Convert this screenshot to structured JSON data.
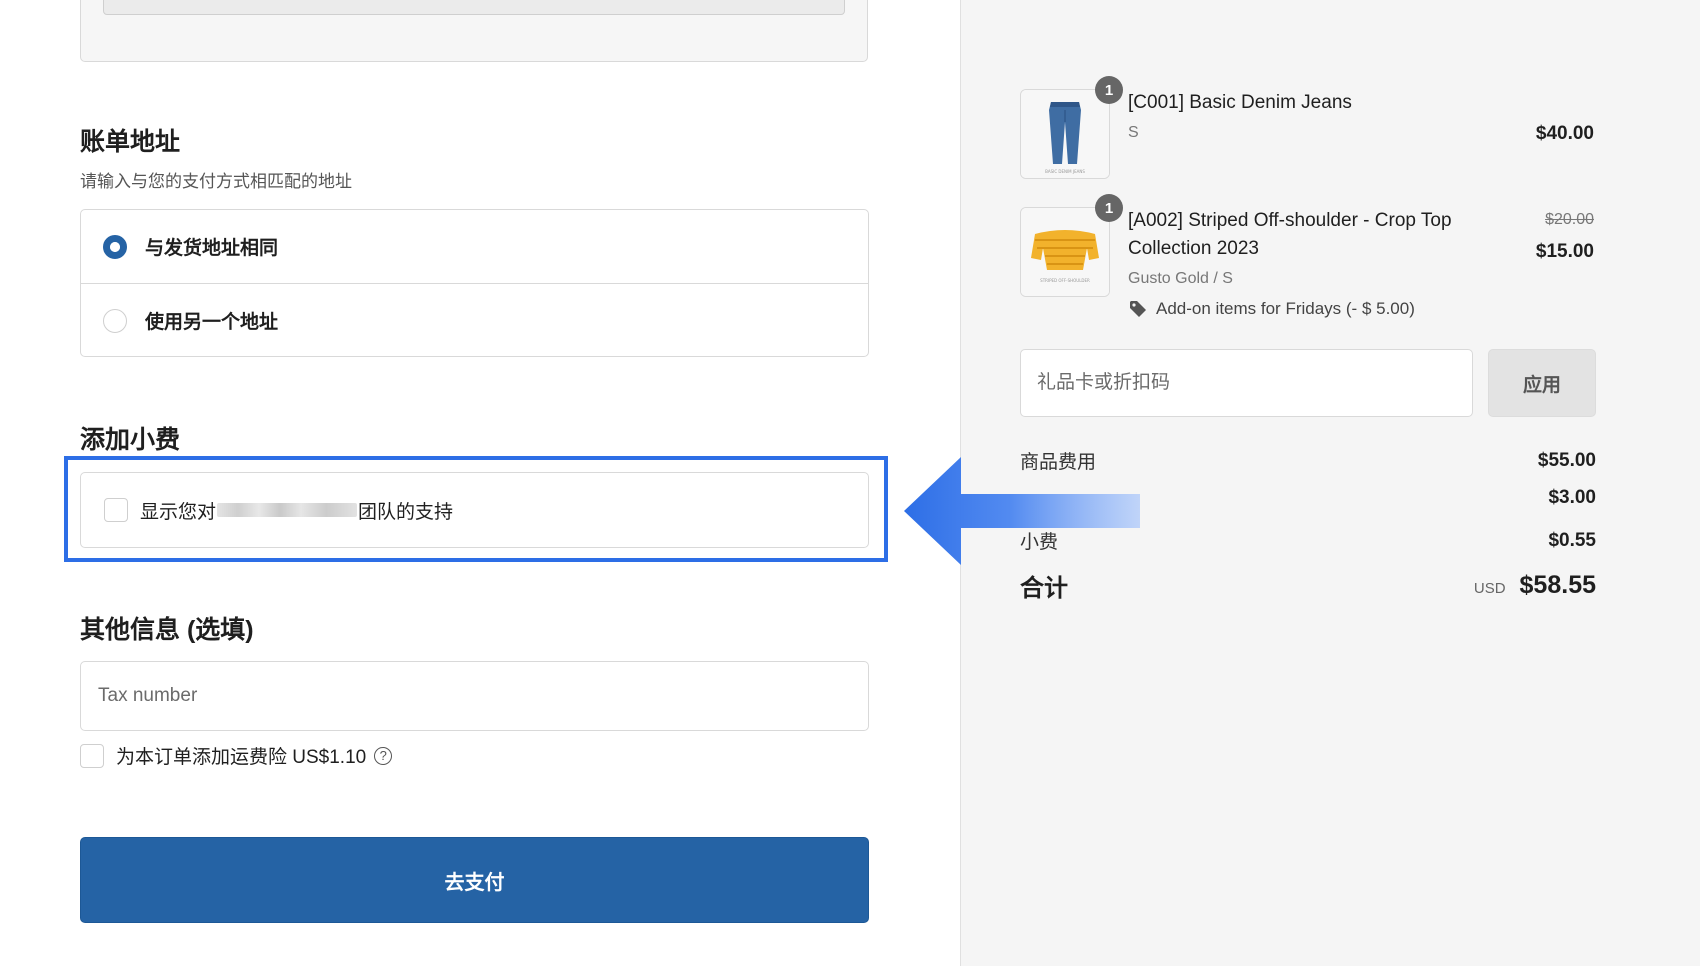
{
  "billing": {
    "title": "账单地址",
    "subtitle": "请输入与您的支付方式相匹配的地址",
    "options": [
      {
        "label": "与发货地址相同",
        "selected": true
      },
      {
        "label": "使用另一个地址",
        "selected": false
      }
    ]
  },
  "tip": {
    "title": "添加小费",
    "text_before": "显示您对",
    "text_after": "团队的支持"
  },
  "other": {
    "title": "其他信息 (选填)",
    "tax_placeholder": "Tax number",
    "insurance_label": "为本订单添加运费险 US$1.10",
    "help_glyph": "?"
  },
  "pay_button": "去支付",
  "cart": {
    "items": [
      {
        "name": "[C001] Basic Denim Jeans",
        "variant": "S",
        "price": "$40.00",
        "quantity": "1"
      },
      {
        "name_line1": "[A002] Striped Off-shoulder - Crop Top",
        "name_line2": "Collection 2023",
        "variant": "Gusto Gold / S",
        "original_price": "$20.00",
        "price": "$15.00",
        "quantity": "1",
        "discount": "Add-on items for Fridays (- $ 5.00)"
      }
    ],
    "gift_placeholder": "礼品卡或折扣码",
    "apply_label": "应用"
  },
  "summary": {
    "subtotal_label": "商品费用",
    "subtotal_value": "$55.00",
    "shipping_value": "$3.00",
    "tip_label": "小费",
    "tip_value": "$0.55",
    "total_label": "合计",
    "currency": "USD",
    "total_value": "$58.55"
  },
  "colors": {
    "primary": "#2563a5",
    "highlight": "#2d6ee6",
    "sidebar_bg": "#f5f5f5"
  }
}
